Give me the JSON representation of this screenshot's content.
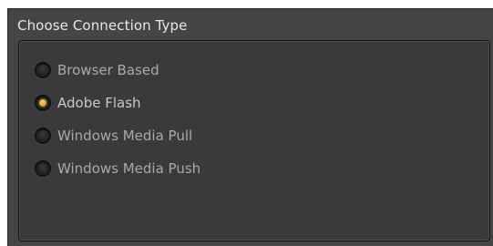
{
  "panel": {
    "title": "Choose Connection Type"
  },
  "connection_types": [
    {
      "label": "Browser Based",
      "selected": false
    },
    {
      "label": "Adobe Flash",
      "selected": true
    },
    {
      "label": "Windows Media Pull",
      "selected": false
    },
    {
      "label": "Windows Media Push",
      "selected": false
    }
  ],
  "colors": {
    "panel_bg": "#454545",
    "group_bg": "#3a3a3a",
    "accent": "#e5a22a",
    "label_text": "#a9a9a9"
  },
  "icons": {
    "radio": "radio-button-icon"
  }
}
